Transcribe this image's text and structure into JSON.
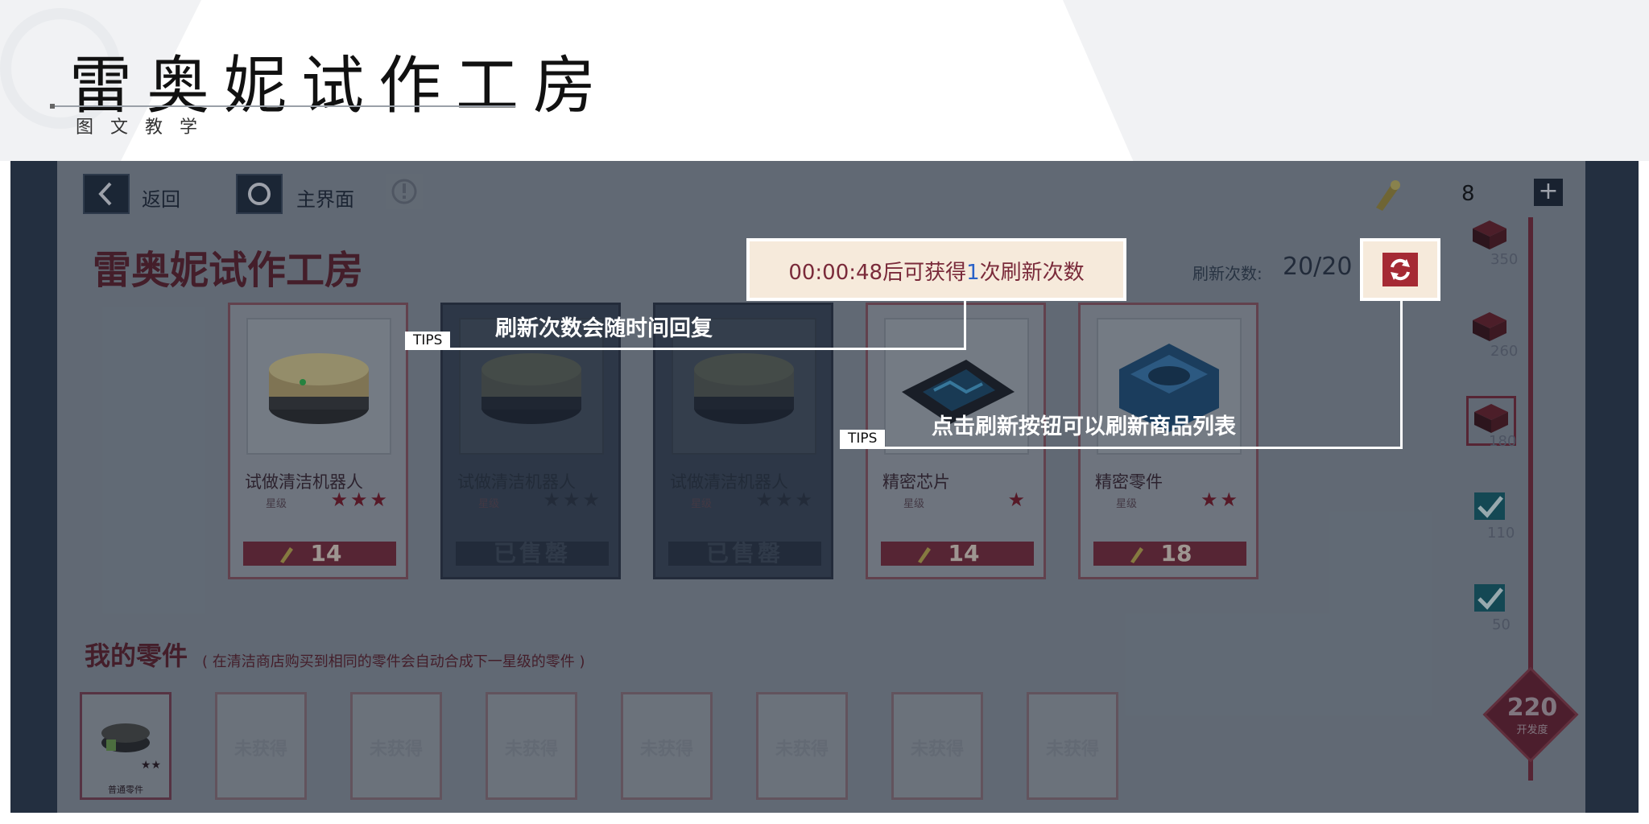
{
  "slide": {
    "title": "雷奥妮试作工房",
    "subtitle": "图文教学"
  },
  "game": {
    "nav": {
      "back_label": "返回",
      "main_label": "主界面"
    },
    "currency_count": "8",
    "plus": "+",
    "title": "雷奥妮试作工房",
    "timer": {
      "prefix": "00:00:48后可获得",
      "highlight": "1",
      "suffix": "次刷新次数"
    },
    "refresh": {
      "label": "刷新次数:",
      "value": "20/20"
    },
    "cards": [
      {
        "name": "试做清洁机器人",
        "grade": "星级",
        "stars": "★★★",
        "price": "14",
        "sold": false
      },
      {
        "name": "试做清洁机器人",
        "grade": "星级",
        "stars": "★★★",
        "price": "已售罄",
        "sold": true
      },
      {
        "name": "试做清洁机器人",
        "grade": "星级",
        "stars": "★★★",
        "price": "已售罄",
        "sold": true
      },
      {
        "name": "精密芯片",
        "grade": "星级",
        "stars": "★",
        "price": "14",
        "sold": false
      },
      {
        "name": "精密零件",
        "grade": "星级",
        "stars": "★★",
        "price": "18",
        "sold": false
      }
    ],
    "parts_title": "我的零件",
    "parts_note": "( 在清洁商店购买到相同的零件会自动合成下一星级的零件 )",
    "parts": {
      "first_stars": "★★",
      "first_label": "普通零件",
      "unobtained": "未获得"
    },
    "progress": {
      "nodes": [
        "350",
        "260",
        "180",
        "110",
        "50"
      ],
      "total": "220",
      "total_label": "开发度"
    }
  },
  "callouts": {
    "tag": "TIPS",
    "first": "刷新次数会随时间回复",
    "second": "点击刷新按钮可以刷新商品列表"
  },
  "colors": {
    "accent": "#7a2a3a",
    "timer_text": "#7a2a3a",
    "timer_highlight": "#2a62c8",
    "timer_bg": "#f6eadb",
    "check": "#1f8a8a"
  }
}
